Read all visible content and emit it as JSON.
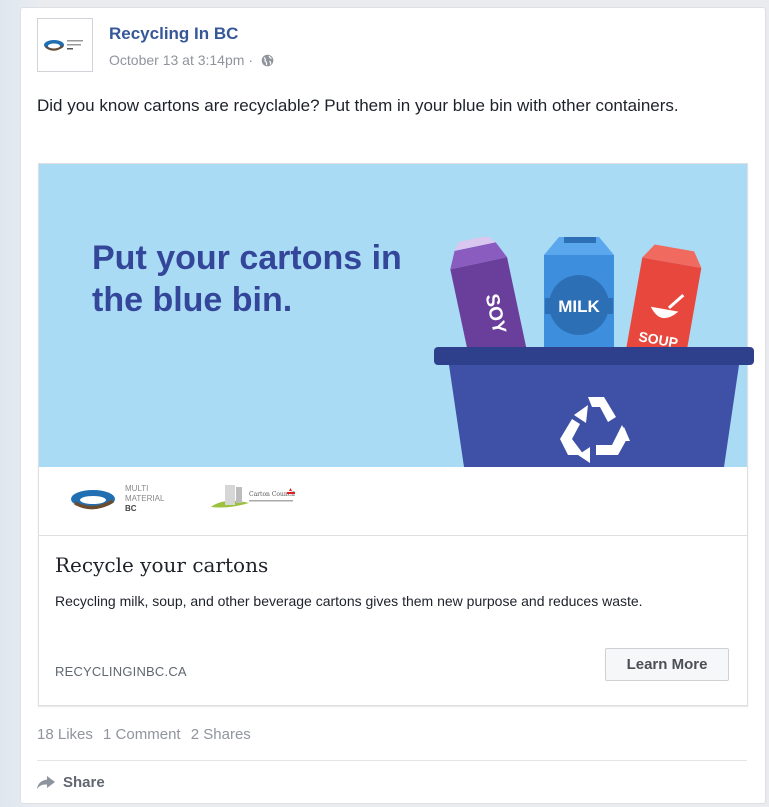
{
  "post": {
    "page_name": "Recycling In BC",
    "timestamp": "October 13 at 3:14pm",
    "separator": "·",
    "privacy_icon": "globe-icon",
    "text": "Did you know cartons are recyclable? Put them in your blue bin with other containers."
  },
  "link_card": {
    "hero": {
      "headline_line1": "Put your cartons in",
      "headline_line2": "the blue bin.",
      "carton_soy": "SOY",
      "carton_milk": "MILK",
      "carton_soup": "SOUP",
      "bin_icon": "recycle-icon"
    },
    "logos": {
      "mmbc_line1": "MULTI",
      "mmbc_line2": "MATERIAL",
      "mmbc_line3": "BC",
      "carton_council": "Carton Council"
    },
    "title": "Recycle your cartons",
    "description": "Recycling milk, soup, and other beverage cartons gives them new purpose and reduces waste.",
    "domain": "RECYCLINGINBC.CA",
    "cta_label": "Learn More"
  },
  "stats": {
    "likes": "18 Likes",
    "comments": "1 Comment",
    "shares": "2 Shares"
  },
  "actions": {
    "share_label": "Share",
    "share_icon": "share-arrow-icon"
  },
  "colors": {
    "link_blue": "#365899",
    "hero_bg": "#a9dbf5",
    "headline": "#34469a",
    "bin_blue": "#3f51a6",
    "soy_purple": "#6a3f9c",
    "milk_blue": "#3d8fdd",
    "soup_red": "#e8473d"
  }
}
